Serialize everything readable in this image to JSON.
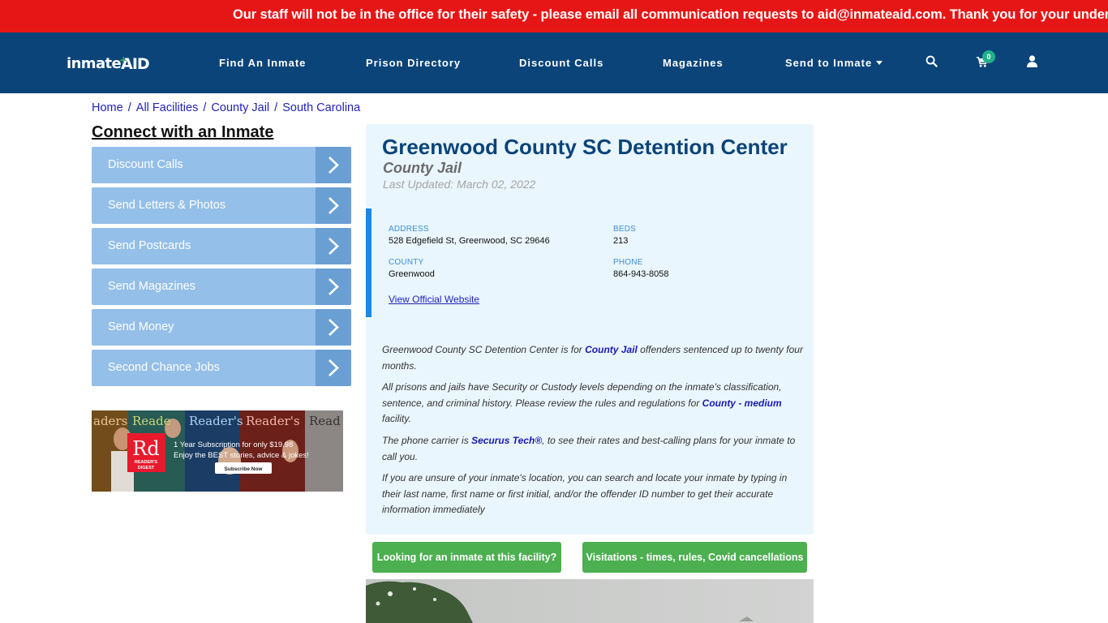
{
  "alert": {
    "text": "Our staff will not be in the office for their safety - please email all communication requests to aid@inmateaid.com. Thank you for your understanding."
  },
  "nav": {
    "logo_left": "inmate",
    "logo_right": "AID",
    "items": [
      {
        "label": "Find An Inmate"
      },
      {
        "label": "Prison Directory"
      },
      {
        "label": "Discount Calls"
      },
      {
        "label": "Magazines"
      },
      {
        "label": "Send to Inmate"
      }
    ],
    "cart_count": "0",
    "icons": [
      "search-icon",
      "cart-icon",
      "user-icon"
    ]
  },
  "breadcrumb": [
    {
      "label": "Home"
    },
    {
      "label": "All Facilities"
    },
    {
      "label": "County Jail"
    },
    {
      "label": "South Carolina"
    }
  ],
  "sidebar": {
    "title": "Connect with an Inmate",
    "items": [
      {
        "label": "Discount Calls"
      },
      {
        "label": "Send Letters & Photos"
      },
      {
        "label": "Send Postcards"
      },
      {
        "label": "Send Magazines"
      },
      {
        "label": "Send Money"
      },
      {
        "label": "Second Chance Jobs"
      }
    ],
    "ad": {
      "brand_logo": "Rd",
      "brand_name_1": "READER'S",
      "brand_name_2": "DIGEST",
      "line1": "1 Year Subscription for only $19.98",
      "line2": "Enjoy the BEST stories, advice & jokes!",
      "cta": "Subscribe Now",
      "cover_titles": [
        "Reader's",
        "Reader's",
        "Reader's",
        "Reader's",
        "Read"
      ]
    }
  },
  "facility": {
    "name": "Greenwood County SC Detention Center",
    "type": "County Jail",
    "last_updated": "Last Updated: March 02, 2022",
    "address_label": "ADDRESS",
    "address": "528 Edgefield St, Greenwood, SC 29646",
    "beds_label": "BEDS",
    "beds": "213",
    "county_label": "COUNTY",
    "county": "Greenwood",
    "phone_label": "PHONE",
    "phone": "864-943-8058",
    "website_link": "View Official Website"
  },
  "description": {
    "p1_a": "Greenwood County SC Detention Center is for ",
    "p1_hl": "County Jail",
    "p1_b": " offenders sentenced up to twenty four months.",
    "p2_a": "All prisons and jails have Security or Custody levels depending on the inmate's classification, sentence, and criminal history. Please review the rules and regulations for ",
    "p2_hl": "County - medium",
    "p2_b": " facility.",
    "p3_a": "The phone carrier is ",
    "p3_hl": "Securus Tech®",
    "p3_b": ", to see their rates and best-calling plans for your inmate to call you.",
    "p4": "If you are unsure of your inmate's location, you can search and locate your inmate by typing in their last name, first name or first initial, and/or the offender ID number to get their accurate information immediately"
  },
  "actions": {
    "find_inmate": "Looking for an inmate at this facility?",
    "visitations": "Visitations - times, rules, Covid cancellations"
  },
  "colors": {
    "alert_bg": "#e71616",
    "nav_bg": "#0b4479",
    "sidebar_item": "#94bfe8",
    "sidebar_arrow": "#6a9fd4",
    "card_bg": "#eaf6fd",
    "accent_blue": "#1a88e8",
    "button_green": "#4caf50",
    "cart_badge": "#1fb28a"
  }
}
